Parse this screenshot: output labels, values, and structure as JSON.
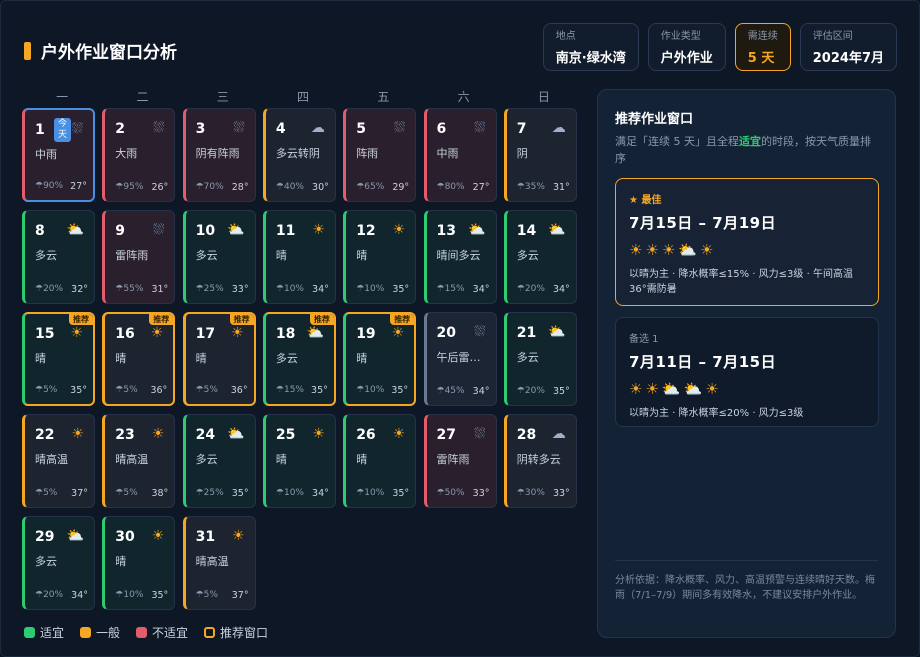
{
  "header": {
    "title": "户外作业窗口分析"
  },
  "chips": [
    {
      "label": "地点",
      "value": "南京·绿水湾",
      "highlight": false
    },
    {
      "label": "作业类型",
      "value": "户外作业",
      "highlight": false
    },
    {
      "label": "需连续",
      "value": "5 天",
      "highlight": true
    },
    {
      "label": "评估区间",
      "value": "2024年7月",
      "highlight": false
    }
  ],
  "weekdays": [
    "一",
    "二",
    "三",
    "四",
    "五",
    "六",
    "日"
  ],
  "days": [
    {
      "d": "1",
      "w": "中雨",
      "p": "90%",
      "t": "27°",
      "s": "bad",
      "i": "rain",
      "today": true,
      "rec": false
    },
    {
      "d": "2",
      "w": "大雨",
      "p": "95%",
      "t": "26°",
      "s": "bad",
      "i": "rain",
      "rec": false
    },
    {
      "d": "3",
      "w": "阴有阵雨",
      "p": "70%",
      "t": "28°",
      "s": "bad",
      "i": "rain",
      "rec": false
    },
    {
      "d": "4",
      "w": "多云转阴",
      "p": "40%",
      "t": "30°",
      "s": "mid",
      "i": "cloud",
      "rec": false
    },
    {
      "d": "5",
      "w": "阵雨",
      "p": "65%",
      "t": "29°",
      "s": "bad",
      "i": "rain",
      "rec": false
    },
    {
      "d": "6",
      "w": "中雨",
      "p": "80%",
      "t": "27°",
      "s": "bad",
      "i": "rain",
      "rec": false
    },
    {
      "d": "7",
      "w": "阴",
      "p": "35%",
      "t": "31°",
      "s": "mid",
      "i": "cloud",
      "rec": false
    },
    {
      "d": "8",
      "w": "多云",
      "p": "20%",
      "t": "32°",
      "s": "good",
      "i": "partly",
      "rec": false
    },
    {
      "d": "9",
      "w": "雷阵雨",
      "p": "55%",
      "t": "31°",
      "s": "bad",
      "i": "rain",
      "rec": false
    },
    {
      "d": "10",
      "w": "多云",
      "p": "25%",
      "t": "33°",
      "s": "good",
      "i": "partly",
      "rec": false
    },
    {
      "d": "11",
      "w": "晴",
      "p": "10%",
      "t": "34°",
      "s": "good",
      "i": "sun",
      "rec": false
    },
    {
      "d": "12",
      "w": "晴",
      "p": "10%",
      "t": "35°",
      "s": "good",
      "i": "sun",
      "rec": false
    },
    {
      "d": "13",
      "w": "晴间多云",
      "p": "15%",
      "t": "34°",
      "s": "good",
      "i": "partly",
      "rec": false
    },
    {
      "d": "14",
      "w": "多云",
      "p": "20%",
      "t": "34°",
      "s": "good",
      "i": "partly",
      "rec": false
    },
    {
      "d": "15",
      "w": "晴",
      "p": "5%",
      "t": "35°",
      "s": "good",
      "i": "sun",
      "rec": true
    },
    {
      "d": "16",
      "w": "晴",
      "p": "5%",
      "t": "36°",
      "s": "mid",
      "i": "sun",
      "rec": true
    },
    {
      "d": "17",
      "w": "晴",
      "p": "5%",
      "t": "36°",
      "s": "mid",
      "i": "sun",
      "rec": true
    },
    {
      "d": "18",
      "w": "多云",
      "p": "15%",
      "t": "35°",
      "s": "good",
      "i": "partly",
      "rec": true
    },
    {
      "d": "19",
      "w": "晴",
      "p": "10%",
      "t": "35°",
      "s": "good",
      "i": "sun",
      "rec": true
    },
    {
      "d": "20",
      "w": "午后雷…",
      "p": "45%",
      "t": "34°",
      "s": "neutral",
      "i": "rain",
      "rec": false
    },
    {
      "d": "21",
      "w": "多云",
      "p": "20%",
      "t": "35°",
      "s": "good",
      "i": "partly",
      "rec": false
    },
    {
      "d": "22",
      "w": "晴高温",
      "p": "5%",
      "t": "37°",
      "s": "mid",
      "i": "sun",
      "rec": false
    },
    {
      "d": "23",
      "w": "晴高温",
      "p": "5%",
      "t": "38°",
      "s": "mid",
      "i": "sun",
      "rec": false
    },
    {
      "d": "24",
      "w": "多云",
      "p": "25%",
      "t": "35°",
      "s": "good",
      "i": "partly",
      "rec": false
    },
    {
      "d": "25",
      "w": "晴",
      "p": "10%",
      "t": "34°",
      "s": "good",
      "i": "sun",
      "rec": false
    },
    {
      "d": "26",
      "w": "晴",
      "p": "10%",
      "t": "35°",
      "s": "good",
      "i": "sun",
      "rec": false
    },
    {
      "d": "27",
      "w": "雷阵雨",
      "p": "50%",
      "t": "33°",
      "s": "bad",
      "i": "rain",
      "rec": false
    },
    {
      "d": "28",
      "w": "阴转多云",
      "p": "30%",
      "t": "33°",
      "s": "mid",
      "i": "cloud",
      "rec": false
    },
    {
      "d": "29",
      "w": "多云",
      "p": "20%",
      "t": "34°",
      "s": "good",
      "i": "partly",
      "rec": false
    },
    {
      "d": "30",
      "w": "晴",
      "p": "10%",
      "t": "35°",
      "s": "good",
      "i": "sun",
      "rec": false
    },
    {
      "d": "31",
      "w": "晴高温",
      "p": "5%",
      "t": "37°",
      "s": "mid",
      "i": "sun",
      "rec": false
    }
  ],
  "labels": {
    "today": "今天",
    "recommend": "推荐"
  },
  "legend": [
    {
      "label": "适宜",
      "color": "#2ecc71"
    },
    {
      "label": "一般",
      "color": "#f5a623"
    },
    {
      "label": "不适宜",
      "color": "#e25c6b"
    },
    {
      "label": "推荐窗口",
      "color": "#f5a623"
    }
  ],
  "panel": {
    "title": "推荐作业窗口",
    "sub_pre": "满足「连续 5 天」且全程",
    "sub_hl": "适宜",
    "sub_post": "的时段，按天气质量排序",
    "best": {
      "tag": "★ 最佳",
      "range": "7月15日 – 7月19日",
      "note": "以晴为主 · 降水概率≤15% · 风力≤3级 · 午间高温36°需防暑"
    },
    "alt": {
      "tag": "备选 1",
      "range": "7月11日 – 7月15日",
      "note": "以晴为主 · 降水概率≤20% · 风力≤3级"
    },
    "basis": "分析依据：降水概率、风力、高温预警与连续晴好天数。梅雨（7/1–7/9）期间多有效降水，不建议安排户外作业。"
  }
}
